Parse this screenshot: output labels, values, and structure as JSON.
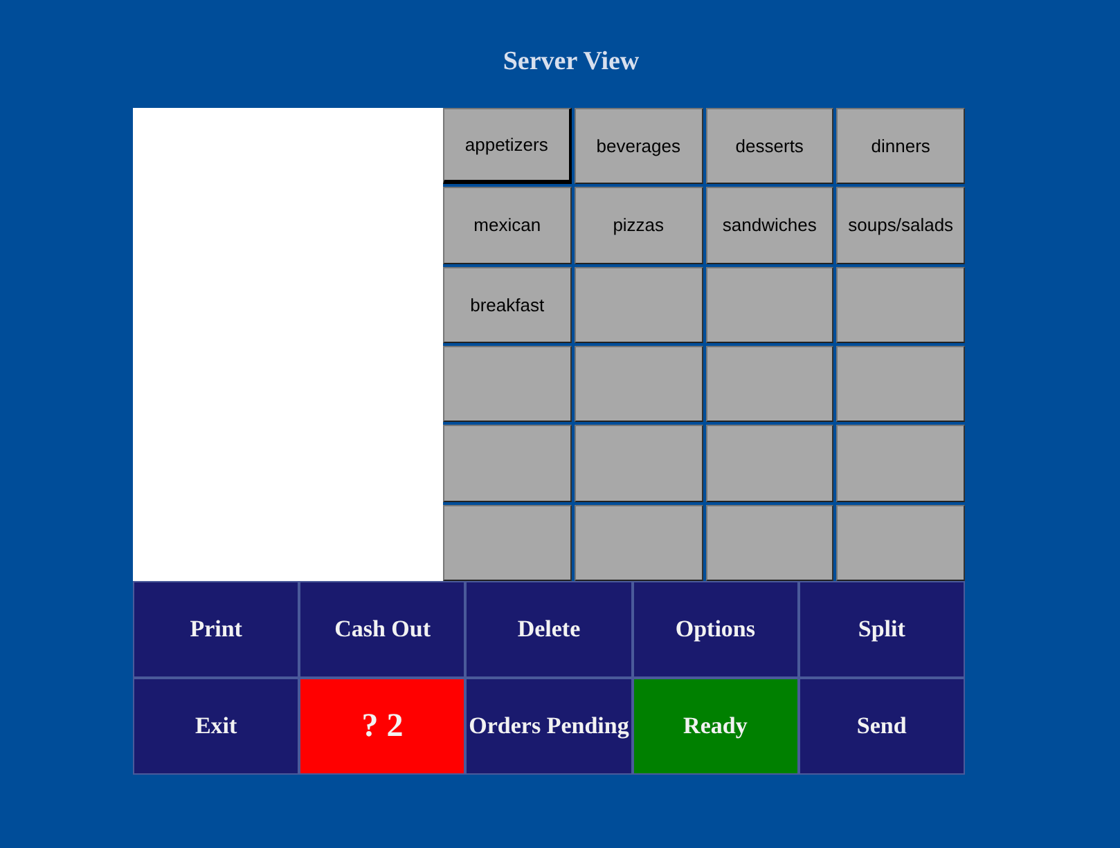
{
  "title": "Server View",
  "categories": [
    {
      "label": "appetizers",
      "selected": true
    },
    {
      "label": "beverages",
      "selected": false
    },
    {
      "label": "desserts",
      "selected": false
    },
    {
      "label": "dinners",
      "selected": false
    },
    {
      "label": "mexican",
      "selected": false
    },
    {
      "label": "pizzas",
      "selected": false
    },
    {
      "label": "sandwiches",
      "selected": false
    },
    {
      "label": "soups/salads",
      "selected": false
    },
    {
      "label": "breakfast",
      "selected": false
    }
  ],
  "actions": [
    {
      "label": "Print",
      "kind": "normal"
    },
    {
      "label": "Cash Out",
      "kind": "normal"
    },
    {
      "label": "Delete",
      "kind": "normal"
    },
    {
      "label": "Options",
      "kind": "normal"
    },
    {
      "label": "Split",
      "kind": "normal"
    },
    {
      "label": "Exit",
      "kind": "normal"
    },
    {
      "label": "? 2",
      "kind": "alert"
    },
    {
      "label": "Orders Pending",
      "kind": "normal"
    },
    {
      "label": "Ready",
      "kind": "ready"
    },
    {
      "label": "Send",
      "kind": "normal"
    }
  ]
}
